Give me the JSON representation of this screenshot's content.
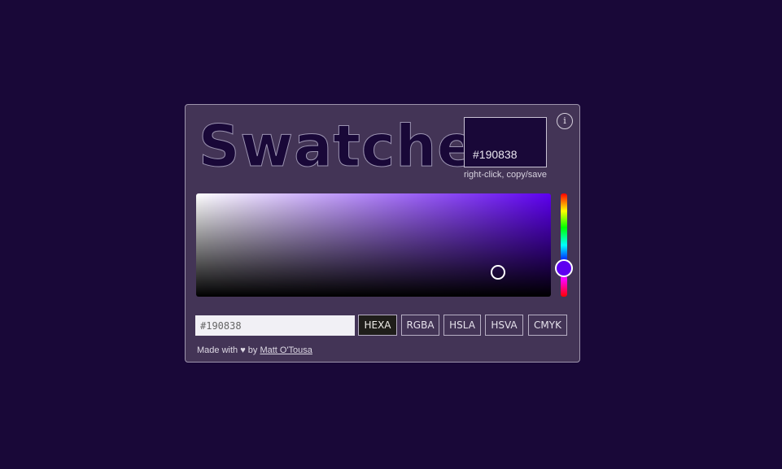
{
  "app": {
    "logo_text": "Swatcher",
    "info_label": "i"
  },
  "swatch": {
    "color": "#190838",
    "hex_label": "#190838",
    "caption": "right-click, copy/save"
  },
  "picker": {
    "hue_color": "#5d00f0",
    "hex_value": "#190838"
  },
  "formats": {
    "buttons": [
      "HEXA",
      "RGBA",
      "HSLA",
      "HSVA",
      "CMYK"
    ],
    "active": "HEXA"
  },
  "footer": {
    "prefix": "Made with ♥ by ",
    "author_link": "Matt O'Tousa"
  },
  "colors": {
    "page_bg": "#190838",
    "panel_bg": "#433456",
    "active_button_bg": "#1f1e1a"
  }
}
